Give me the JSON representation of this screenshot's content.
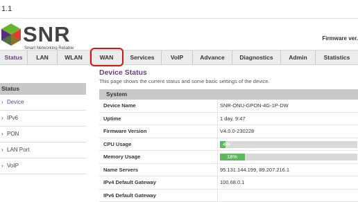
{
  "window": {
    "title": "1.1"
  },
  "brand": {
    "name": "SNR",
    "tagline": "Smart Networking Reliable"
  },
  "firmware_label": "Firmware ver.",
  "nav": {
    "items": [
      "Status",
      "LAN",
      "WLAN",
      "WAN",
      "Services",
      "VoIP",
      "Advance",
      "Diagnostics",
      "Admin",
      "Statistics"
    ],
    "active": "Status",
    "highlighted": "WAN"
  },
  "sidebar": {
    "header": "Status",
    "items": [
      "Device",
      "IPv6",
      "PON",
      "LAN Port",
      "VoIP"
    ],
    "active": "Device"
  },
  "page": {
    "title": "Device Status",
    "description": "This page shows the current status and some basic settings of the device."
  },
  "section": {
    "title": "System",
    "rows": [
      {
        "label": "Device Name",
        "value": "SNR-ONU-GPON-4G-1P-DW"
      },
      {
        "label": "Uptime",
        "value": "1 day,  9:47"
      },
      {
        "label": "Firmware Version",
        "value": "V4.0.0-230228"
      },
      {
        "label": "CPU Usage",
        "value": "4%",
        "percent": 4
      },
      {
        "label": "Memory Usage",
        "value": "18%",
        "percent": 18
      },
      {
        "label": "Name Servers",
        "value": "95.131.144.199, 89.207.216.1"
      },
      {
        "label": "IPv4 Default Gateway",
        "value": "100.68.0.1"
      },
      {
        "label": "IPv6 Default Gateway",
        "value": ""
      }
    ]
  },
  "colors": {
    "accent": "#6b3a8a",
    "highlight": "#d01818",
    "progress": "#5cb85c",
    "logo_green": "#6ab42d",
    "logo_purple": "#5b2d82",
    "logo_red": "#e53935"
  }
}
